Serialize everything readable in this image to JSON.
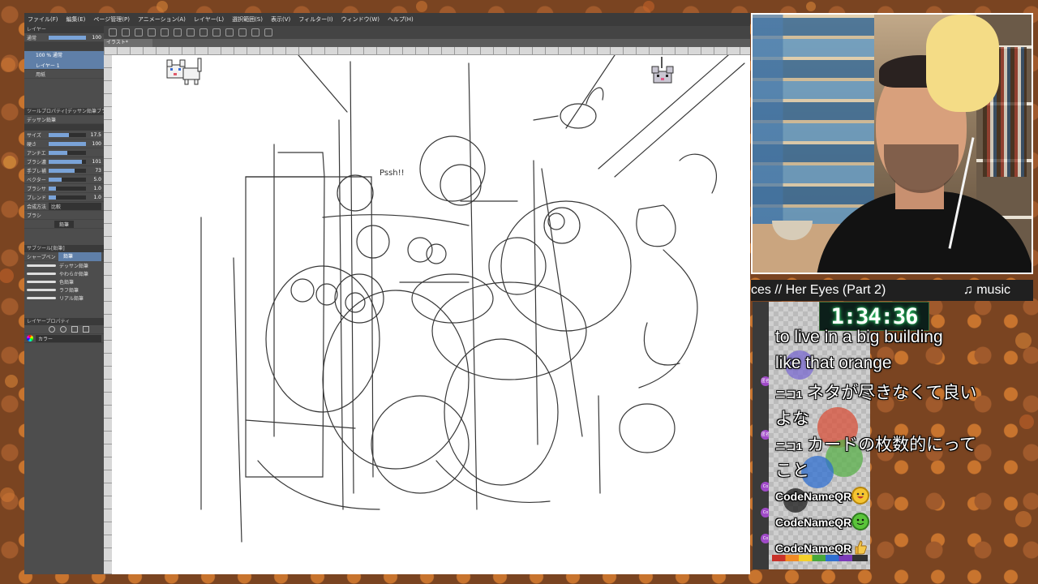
{
  "app": {
    "menu": [
      "ファイル(F)",
      "編集(E)",
      "ページ管理(P)",
      "アニメーション(A)",
      "レイヤー(L)",
      "選択範囲(S)",
      "表示(V)",
      "フィルター(I)",
      "ウィンドウ(W)",
      "ヘルプ(H)"
    ],
    "document_tab": "イラスト*",
    "layer_panel": {
      "header": "レイヤー",
      "blend_mode": "通常",
      "opacity_value": "100",
      "layer_selected_line1": "100 % 通常",
      "layer_selected_line2": "レイヤー 1",
      "layer_paper": "用紙"
    },
    "tool_property": {
      "header": "ツールプロパティ[デッサン鉛筆ブラシ]",
      "tool_name": "デッサン鉛筆",
      "rows": [
        {
          "label": "サイズ",
          "value": "17.5",
          "level": 0.55
        },
        {
          "label": "硬さ",
          "value": "100",
          "level": 1.0
        },
        {
          "label": "アンチエイリアス",
          "value": "",
          "level": 0.5
        },
        {
          "label": "ブラシ濃度",
          "value": "101",
          "level": 0.9
        },
        {
          "label": "手ブレ補正",
          "value": "73",
          "level": 0.7
        },
        {
          "label": "ベクター吸着",
          "value": "5.0",
          "level": 0.35
        },
        {
          "label": "ブラシサイズ",
          "value": "1.0",
          "level": 0.2
        },
        {
          "label": "ブレンド",
          "value": "1.0",
          "level": 0.2
        }
      ],
      "combine_label": "合成方法",
      "combine_value": "比較",
      "brush_label": "ブラシ",
      "eraser_label": "鉛筆"
    },
    "sub_tool": {
      "header": "サブツール[鉛筆]",
      "tabs": [
        "シャープペン",
        "鉛筆"
      ],
      "items": [
        "デッサン鉛筆",
        "やわらか鉛筆",
        "色鉛筆",
        "ラフ鉛筆",
        "リアル鉛筆"
      ]
    },
    "color_panel": {
      "header": "レイヤープロパティ",
      "dropdown": "カラー"
    },
    "sketch_label": "Pssh!!"
  },
  "stream": {
    "ticker_text": "ces // Her Eyes (Part 2)",
    "ticker_music": "♫ music",
    "timer": "1:34:36",
    "chat": [
      {
        "text": "to live in a big building"
      },
      {
        "text": "like that orange"
      },
      {
        "user": "ニコ1",
        "text": "ネタが尽きなくて良い"
      },
      {
        "text": "よな"
      },
      {
        "user": "ニコ1",
        "text": "カードの枚数的にって"
      },
      {
        "text": "こと"
      },
      {
        "user": "CodeNameQR",
        "emote": "grin"
      },
      {
        "user": "CodeNameQR",
        "emote": "green-face"
      },
      {
        "user": "CodeNameQR",
        "emote": "thumbs-up"
      }
    ],
    "badges": [
      "匿名",
      "匿名",
      "Co",
      "Co",
      "Co"
    ]
  },
  "colors": {
    "frame": "#7a4421",
    "menubar": "#3b3b3b",
    "timer_glow": "#2fd06a",
    "badge": "#a04ac8"
  }
}
